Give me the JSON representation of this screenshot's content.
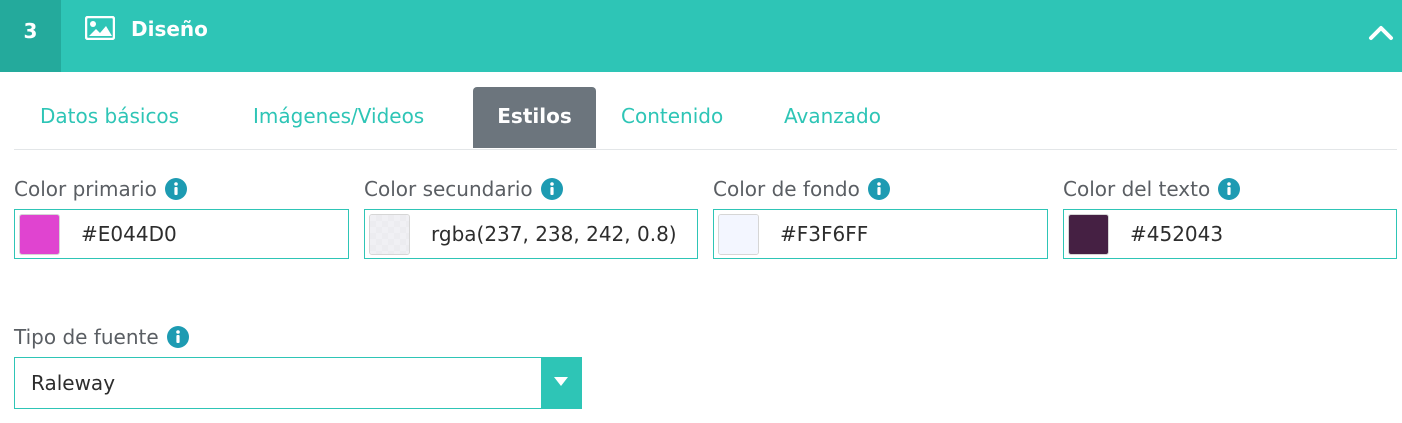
{
  "header": {
    "step": "3",
    "icon": "image-icon",
    "title": "Diseño",
    "collapse_icon": "chevron-up-icon",
    "colors": {
      "bar": "#2ec5b6",
      "step_bg": "#24aa9c"
    }
  },
  "tabs": [
    {
      "label": "Datos básicos",
      "active": false
    },
    {
      "label": "Imágenes/Videos",
      "active": false
    },
    {
      "label": "Estilos",
      "active": true
    },
    {
      "label": "Contenido",
      "active": false
    },
    {
      "label": "Avanzado",
      "active": false
    }
  ],
  "fields": {
    "primary": {
      "label": "Color primario",
      "value": "#E044D0",
      "swatch": "#E044D0"
    },
    "secondary": {
      "label": "Color secundario",
      "value": "rgba(237, 238, 242, 0.8)",
      "swatch": "rgba(237, 238, 242, 0.8)"
    },
    "background": {
      "label": "Color de fondo",
      "value": "#F3F6FF",
      "swatch": "#F3F6FF"
    },
    "text": {
      "label": "Color del texto",
      "value": "#452043",
      "swatch": "#452043"
    },
    "font": {
      "label": "Tipo de fuente",
      "value": "Raleway"
    }
  },
  "icons": {
    "info": "info-circle-icon",
    "dropdown": "caret-down-icon"
  }
}
